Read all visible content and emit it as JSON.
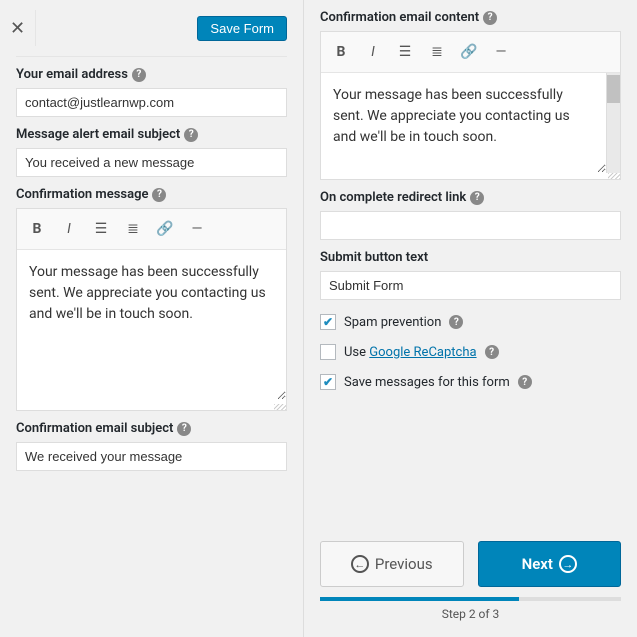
{
  "topbar": {
    "save_label": "Save Form"
  },
  "left": {
    "email_label": "Your email address",
    "email_value": "contact@justlearnwp.com",
    "alert_label": "Message alert email subject",
    "alert_value": "You received a new message",
    "confirm_msg_label": "Confirmation message",
    "confirm_msg_value": "Your message has been successfully sent. We appreciate you contacting us and we'll be in touch soon.",
    "confirm_subj_label": "Confirmation email subject",
    "confirm_subj_value": "We received your message"
  },
  "right": {
    "confirm_email_content_label": "Confirmation email content",
    "confirm_email_content_value": "Your message has been successfully sent. We appreciate you contacting us and we'll be in touch soon.",
    "redirect_label": "On complete redirect link",
    "redirect_value": "",
    "submit_text_label": "Submit button text",
    "submit_text_value": "Submit Form",
    "spam_label": "Spam prevention",
    "recaptcha_prefix": "Use",
    "recaptcha_link": "Google ReCaptcha",
    "save_msgs_label": "Save messages for this form"
  },
  "checks": {
    "spam": true,
    "recaptcha": false,
    "save_msgs": true
  },
  "nav": {
    "previous": "Previous",
    "next": "Next",
    "step": "Step 2 of 3"
  }
}
